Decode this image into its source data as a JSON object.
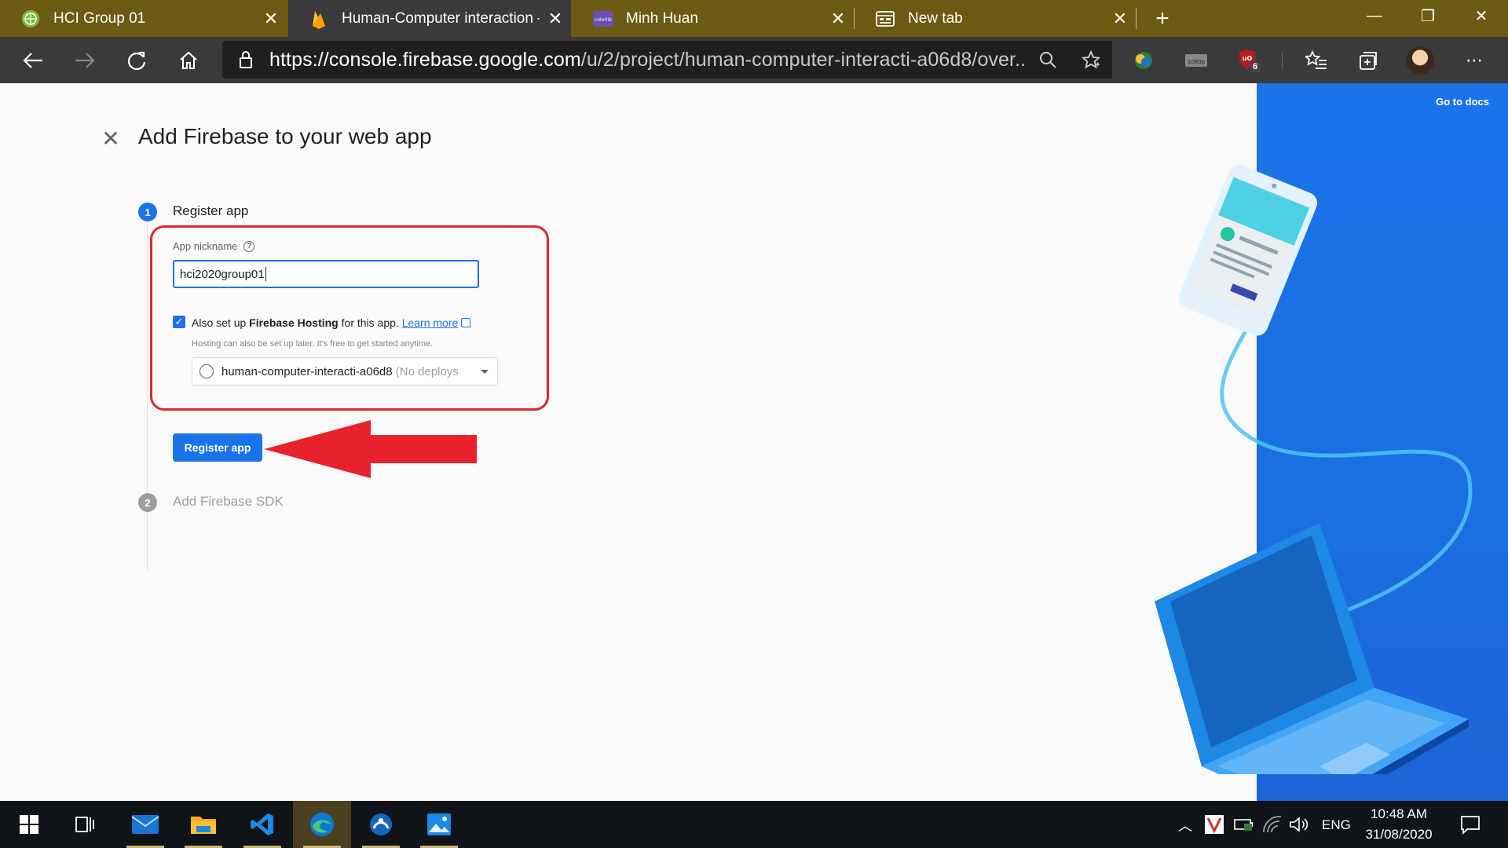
{
  "browser": {
    "tabs": [
      {
        "title": "HCI Group 01",
        "favicon": "green-globe-icon",
        "active": false
      },
      {
        "title": "Human-Computer interaction – F",
        "favicon": "firebase-flame-icon",
        "active": true
      },
      {
        "title": "Minh Huan",
        "favicon": "colorlib-icon",
        "active": false
      },
      {
        "title": "New tab",
        "favicon": "newtab-page-icon",
        "active": false
      }
    ],
    "new_tab_symbol": "+",
    "window_controls": {
      "minimize": "—",
      "restore": "❐",
      "close": "✕"
    },
    "address": {
      "url_host": "https://console.firebase.google.com",
      "url_path": "/u/2/project/human-computer-interacti-a06d8/over..."
    },
    "extension_badge_count": "6"
  },
  "dialog": {
    "close_symbol": "✕",
    "title": "Add Firebase to your web app",
    "steps": [
      {
        "number": "1",
        "label": "Register app",
        "state": "active"
      },
      {
        "number": "2",
        "label": "Add Firebase SDK",
        "state": "inactive"
      }
    ],
    "nickname": {
      "label": "App nickname",
      "help_symbol": "?",
      "value": "hci2020group01"
    },
    "hosting": {
      "checked": true,
      "text_prefix": "Also set up ",
      "text_bold": "Firebase Hosting",
      "text_suffix": " for this app. ",
      "learn_more": "Learn more",
      "subtext": "Hosting can also be set up later. It's free to get started anytime.",
      "site_value": "human-computer-interacti-a06d8",
      "site_status": " (No deploys"
    },
    "register_button": "Register app"
  },
  "side_panel": {
    "docs_link": "Go to docs"
  },
  "taskbar": {
    "items": [
      "windows-start-icon",
      "task-view-icon",
      "mail-icon",
      "file-explorer-icon",
      "vscode-icon",
      "edge-icon",
      "teamviewer-icon",
      "photos-icon"
    ],
    "language": "ENG",
    "time": "10:48 AM",
    "date": "31/08/2020"
  },
  "colors": {
    "tab_strip": "#6b5a12",
    "toolbar": "#3a3a3a",
    "firebase_blue": "#1a73e8",
    "highlight_red": "#e0242e"
  }
}
